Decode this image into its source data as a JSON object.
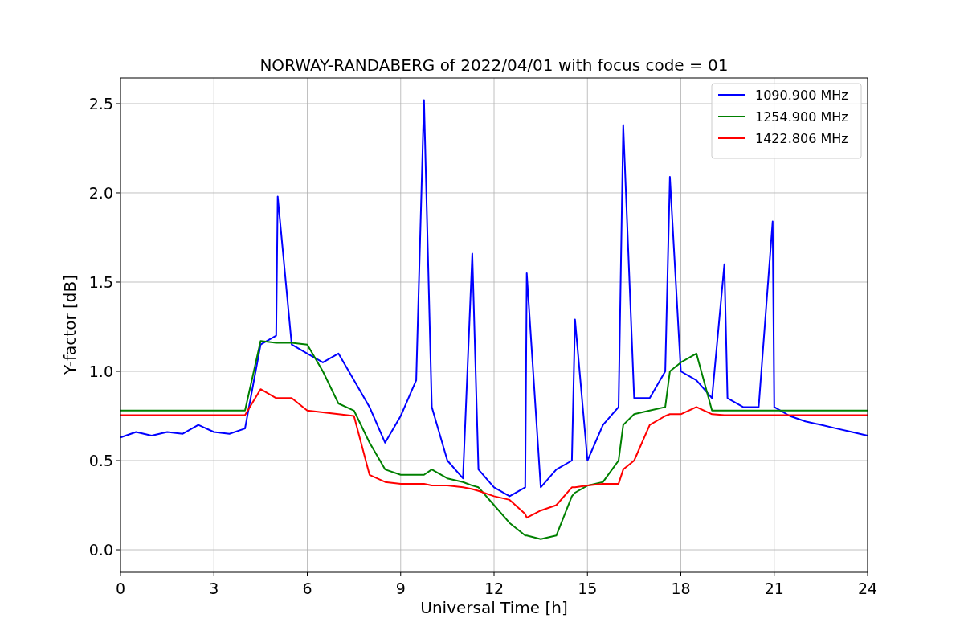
{
  "chart_data": {
    "type": "line",
    "title": "NORWAY-RANDABERG of 2022/04/01 with focus code = 01",
    "xlabel": "Universal Time [h]",
    "ylabel": "Y-factor [dB]",
    "x": [
      0,
      0.5,
      1,
      1.5,
      2,
      2.5,
      3,
      3.5,
      4,
      4.5,
      5,
      5.05,
      5.5,
      6,
      6.5,
      7,
      7.5,
      8,
      8.5,
      9,
      9.5,
      9.75,
      10,
      10.5,
      11,
      11.3,
      11.5,
      12,
      12.5,
      13,
      13.05,
      13.5,
      14,
      14.5,
      14.6,
      15,
      15.5,
      16,
      16.15,
      16.5,
      17,
      17.5,
      17.65,
      18,
      18.5,
      19,
      19.4,
      19.5,
      20,
      20.5,
      20.95,
      21,
      21.5,
      22,
      22.5,
      23,
      23.5,
      24
    ],
    "series": [
      {
        "name": "1090.900 MHz",
        "color": "#0000ff",
        "values": [
          0.63,
          0.66,
          0.64,
          0.66,
          0.65,
          0.7,
          0.66,
          0.65,
          0.68,
          1.15,
          1.2,
          1.98,
          1.15,
          1.1,
          1.05,
          1.1,
          0.95,
          0.8,
          0.6,
          0.75,
          0.95,
          2.52,
          0.8,
          0.5,
          0.4,
          1.66,
          0.45,
          0.35,
          0.3,
          0.35,
          1.55,
          0.35,
          0.45,
          0.5,
          1.29,
          0.5,
          0.7,
          0.8,
          2.38,
          0.85,
          0.85,
          1.0,
          2.09,
          1.0,
          0.95,
          0.85,
          1.6,
          0.85,
          0.8,
          0.8,
          1.84,
          0.8,
          0.75,
          0.72,
          0.7,
          0.68,
          0.66,
          0.64
        ]
      },
      {
        "name": "1254.900 MHz",
        "color": "#008000",
        "values": [
          0.78,
          0.78,
          0.78,
          0.78,
          0.78,
          0.78,
          0.78,
          0.78,
          0.78,
          1.17,
          1.16,
          1.16,
          1.16,
          1.15,
          1.0,
          0.82,
          0.78,
          0.6,
          0.45,
          0.42,
          0.42,
          0.42,
          0.45,
          0.4,
          0.38,
          0.36,
          0.35,
          0.25,
          0.15,
          0.08,
          0.08,
          0.06,
          0.08,
          0.3,
          0.32,
          0.36,
          0.38,
          0.5,
          0.7,
          0.76,
          0.78,
          0.8,
          1.0,
          1.05,
          1.1,
          0.78,
          0.78,
          0.78,
          0.78,
          0.78,
          0.78,
          0.78,
          0.78,
          0.78,
          0.78,
          0.78,
          0.78,
          0.78
        ]
      },
      {
        "name": "1422.806 MHz",
        "color": "#ff0000",
        "values": [
          0.755,
          0.755,
          0.755,
          0.755,
          0.755,
          0.755,
          0.755,
          0.755,
          0.755,
          0.9,
          0.85,
          0.85,
          0.85,
          0.78,
          0.77,
          0.76,
          0.75,
          0.42,
          0.38,
          0.37,
          0.37,
          0.37,
          0.36,
          0.36,
          0.35,
          0.34,
          0.33,
          0.3,
          0.28,
          0.2,
          0.18,
          0.22,
          0.25,
          0.35,
          0.35,
          0.36,
          0.37,
          0.37,
          0.45,
          0.5,
          0.7,
          0.75,
          0.76,
          0.76,
          0.8,
          0.76,
          0.755,
          0.755,
          0.755,
          0.755,
          0.755,
          0.755,
          0.755,
          0.755,
          0.755,
          0.755,
          0.755,
          0.755
        ]
      }
    ],
    "grid": true,
    "legend": true,
    "xlim": [
      0,
      24
    ],
    "ylim": [
      -0.126,
      2.644
    ],
    "xticks": [
      0,
      3,
      6,
      9,
      12,
      15,
      18,
      21,
      24
    ],
    "yticks": [
      {
        "value": 0,
        "label": "0.0"
      },
      {
        "value": 0.5,
        "label": "0.5"
      },
      {
        "value": 1,
        "label": "1.0"
      },
      {
        "value": 1.5,
        "label": "1.5"
      },
      {
        "value": 2,
        "label": "2.0"
      },
      {
        "value": 2.5,
        "label": "2.5"
      }
    ]
  }
}
